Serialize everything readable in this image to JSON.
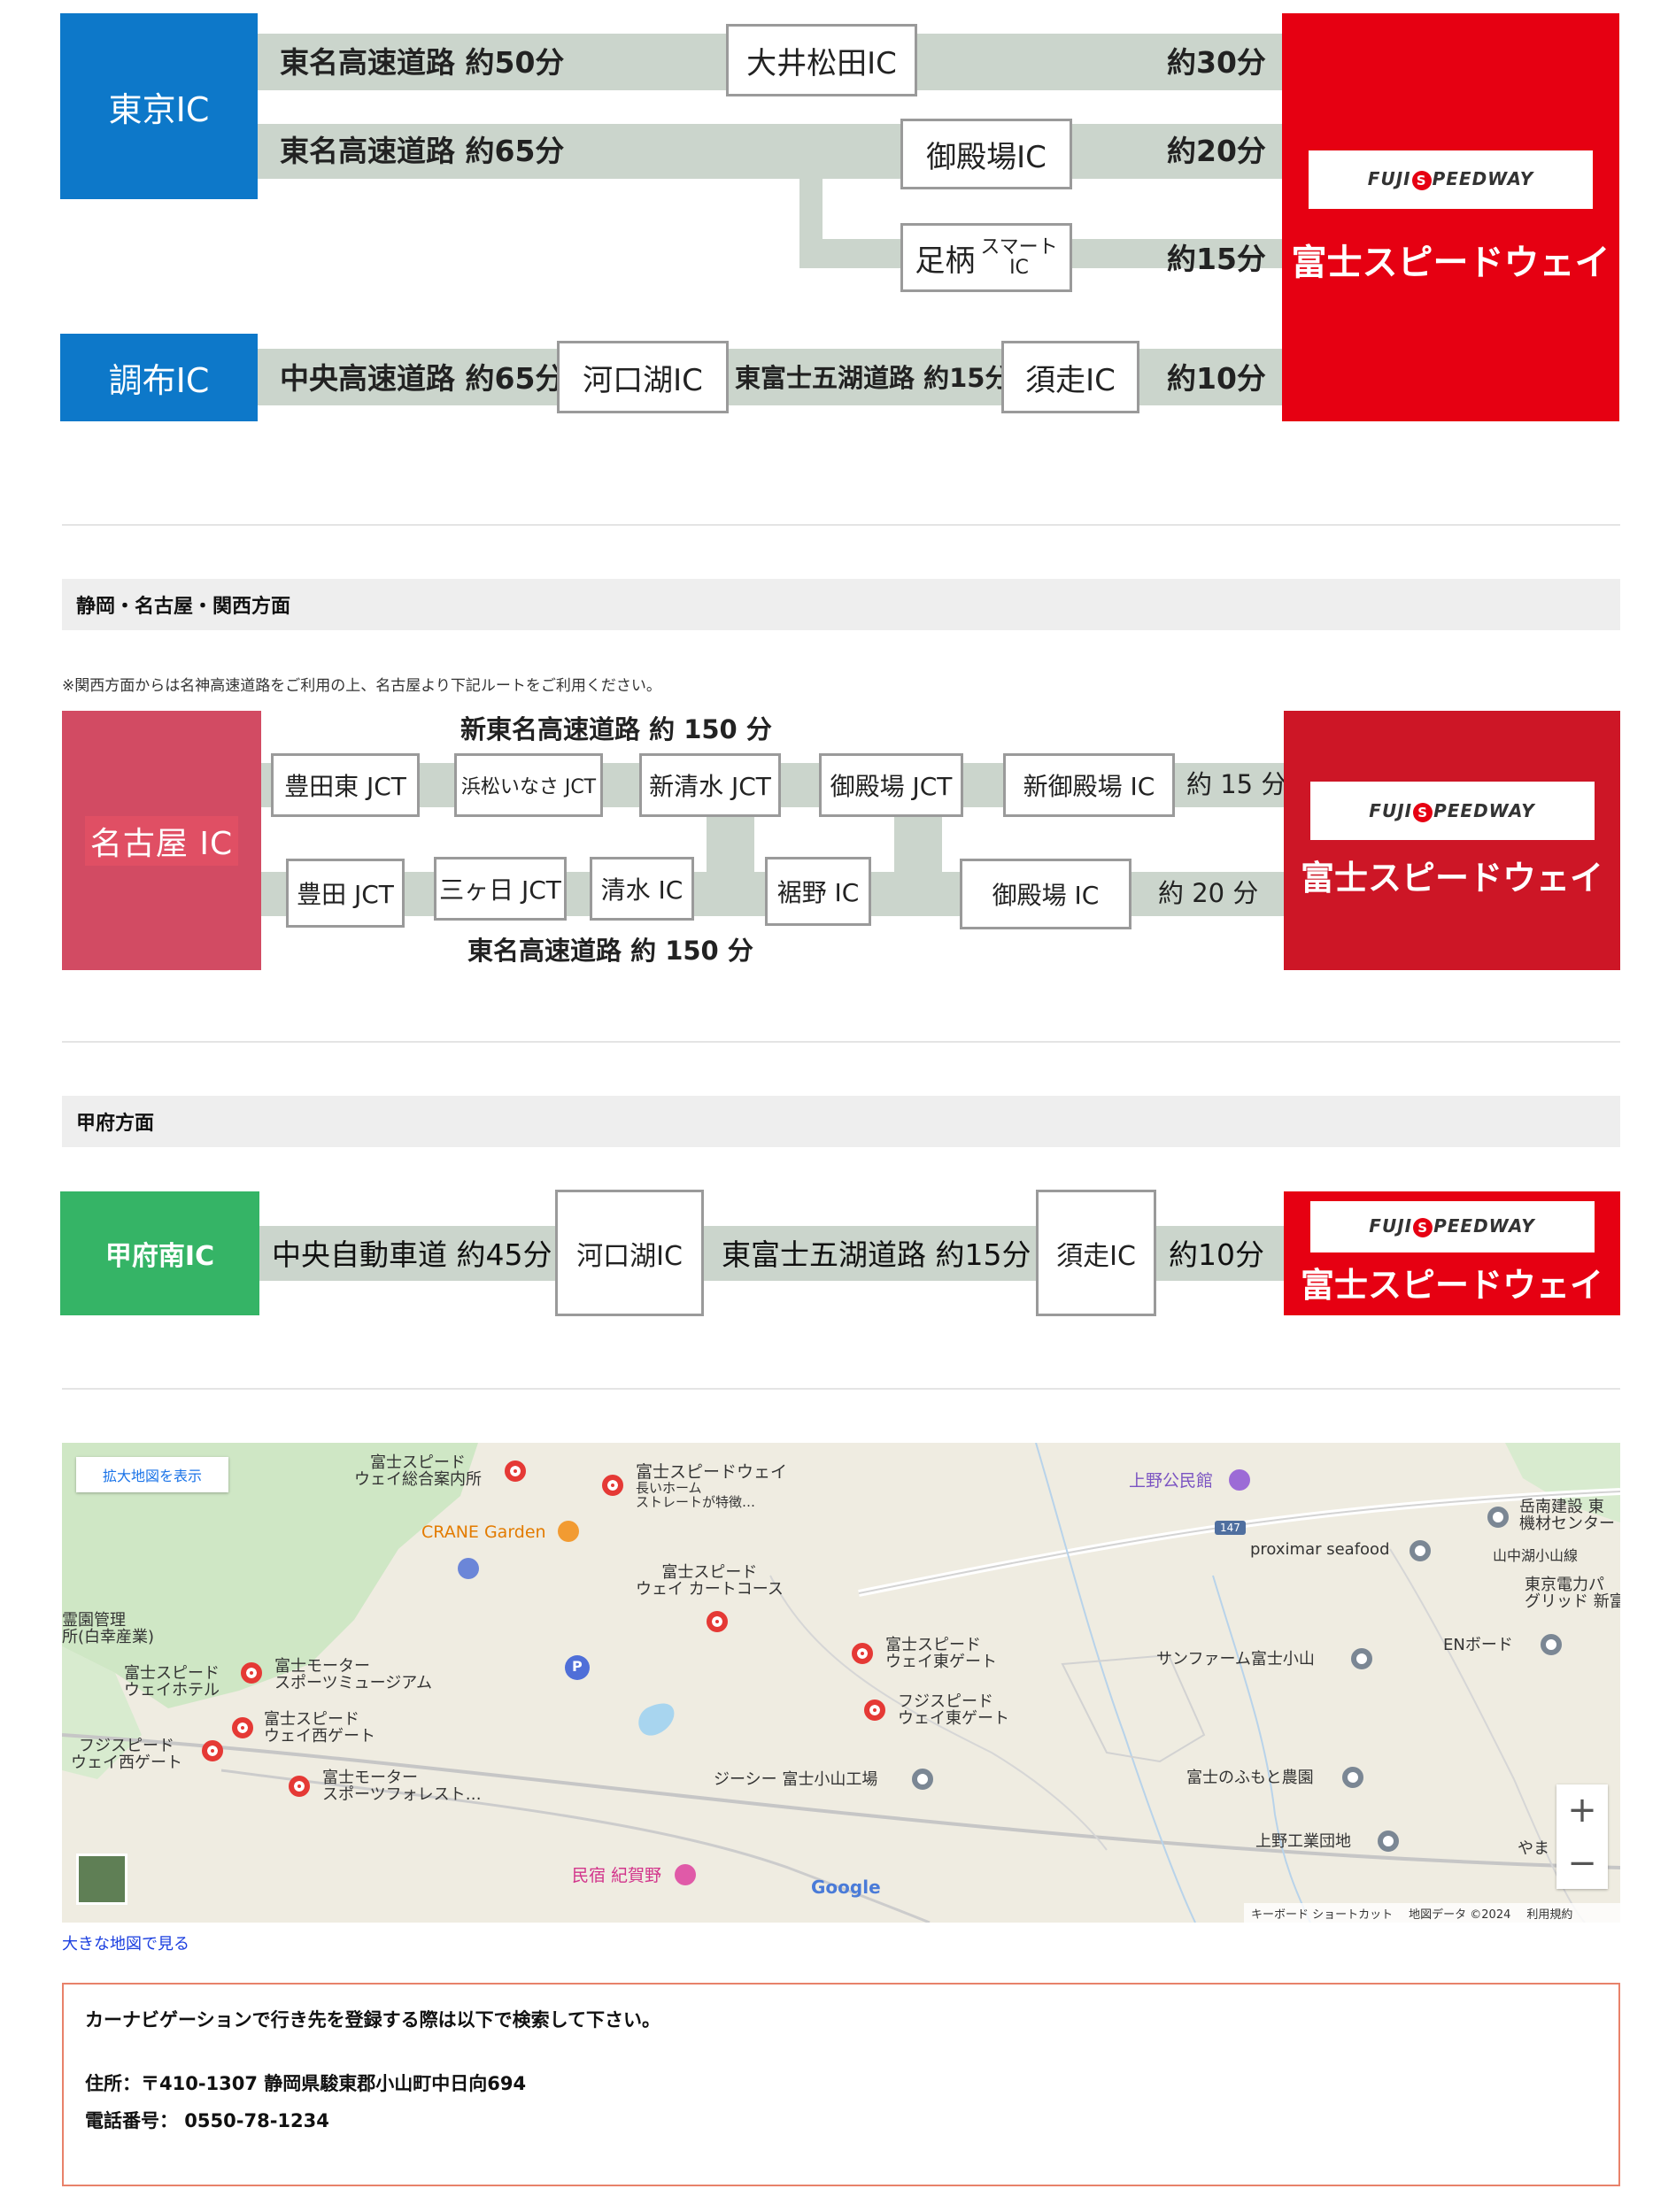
{
  "tokyo_routes": {
    "tokyo_ic": "東京IC",
    "chofu_ic": "調布IC",
    "tomei_50": "東名高速道路 約50分",
    "oimatsuda_ic": "大井松田IC",
    "min_30": "約30分",
    "tomei_65": "東名高速道路 約65分",
    "gotemba_ic": "御殿場IC",
    "min_20": "約20分",
    "ashigara": "足柄",
    "smart": "スマート",
    "ic": "IC",
    "min_15": "約15分",
    "chuo_65": "中央高速道路 約65分",
    "kawaguchiko_ic": "河口湖IC",
    "higashifuji_15": "東富士五湖道路 約15分",
    "subashiri_ic": "須走IC",
    "min_10": "約10分"
  },
  "logo": {
    "text_a": "FUJI",
    "text_s": "S",
    "text_b": "PEEDWAY",
    "name": "富士スピードウェイ"
  },
  "nagoya_section": {
    "title": "静岡・名古屋・関西方面",
    "note": "※関西方面からは名神高速道路をご利用の上、名古屋より下記ルートをご利用ください。",
    "nagoya_ic": "名古屋 IC",
    "shin_tomei": "新東名高速道路 約 150 分",
    "toyotahigashi_jct": "豊田東 JCT",
    "hamamatsu_inasa_jct": "浜松いなさ JCT",
    "shinshimizu_jct": "新清水 JCT",
    "gotemba_jct": "御殿場 JCT",
    "shingotemba_ic": "新御殿場 IC",
    "min_15": "約 15 分",
    "toyota_jct": "豊田 JCT",
    "mikkabi_jct": "三ヶ日 JCT",
    "shimizu_ic": "清水 IC",
    "susono_ic": "裾野 IC",
    "gotemba_ic": "御殿場 IC",
    "min_20": "約 20 分",
    "tomei_150": "東名高速道路 約 150 分"
  },
  "kofu_section": {
    "title": "甲府方面",
    "kofuminami_ic": "甲府南IC",
    "chuo_45": "中央自動車道 約45分",
    "kawaguchiko_ic": "河口湖IC",
    "higashifuji_15": "東富士五湖道路 約15分",
    "subashiri_ic": "須走IC",
    "min_10": "約10分"
  },
  "map": {
    "enlarge_button": "拡大地図を表示",
    "labels": {
      "info_center_1": "富士スピード",
      "info_center_2": "ウェイ総合案内所",
      "fsw_1": "富士スピードウェイ",
      "fsw_2": "長いホーム",
      "fsw_3": "ストレートが特徴…",
      "crane": "CRANE Garden",
      "kart_1": "富士スピード",
      "kart_2": "ウェイ カートコース",
      "ueno": "上野公民館",
      "route147": "147",
      "gakunan_1": "岳南建設 東",
      "gakunan_2": "機材センター",
      "proximar": "proximar seafood",
      "yamanakako": "山中湖小山線",
      "tepco_1": "東京電力パ",
      "tepco_2": "グリッド 新富士変",
      "reien_1": "霊園管理",
      "reien_2": "所(白幸産業)",
      "hotel_1": "富士スピード",
      "hotel_2": "ウェイホテル",
      "museum_1": "富士モーター",
      "museum_2": "スポーツミュージアム",
      "westgate_1": "富士スピード",
      "westgate_2": "ウェイ西ゲート",
      "westgate2_1": "フジスピード",
      "westgate2_2": "ウェイ西ゲート",
      "forest_1": "富士モーター",
      "forest_2": "スポーツフォレスト…",
      "eastgate_1": "富士スピード",
      "eastgate_2": "ウェイ東ゲート",
      "eastgate2_1": "フジスピード",
      "eastgate2_2": "ウェイ東ゲート",
      "sunfarm": "サンファーム富士小山",
      "en_board": "ENボード",
      "jc": "ジーシー 富士小山工場",
      "fumoto": "富士のふもと農園",
      "ueno_industrial": "上野工業団地",
      "yama": "やま",
      "minshuku": "民宿 紀賀野",
      "google": "Google",
      "parking": "P"
    },
    "zoom_in": "+",
    "zoom_out": "−",
    "footer_shortcut": "キーボード ショートカット",
    "footer_data": "地図データ ©2024",
    "footer_terms": "利用規約"
  },
  "large_map_link": "大きな地図で見る",
  "navi": {
    "intro": "カーナビゲーションで行き先を登録する際は以下で検索して下さい。",
    "address": "住所：〒410-1307 静岡県駿東郡小山町中日向694",
    "phone": "電話番号： 0550-78-1234"
  },
  "colors": {
    "tokyo_blue": "#0d78c9",
    "nagoya_pink": "#d24b63",
    "kofu_green": "#35b466",
    "fsw_red": "#e60012",
    "road_gray": "#cbd5cc",
    "navi_border": "#e8826a"
  }
}
